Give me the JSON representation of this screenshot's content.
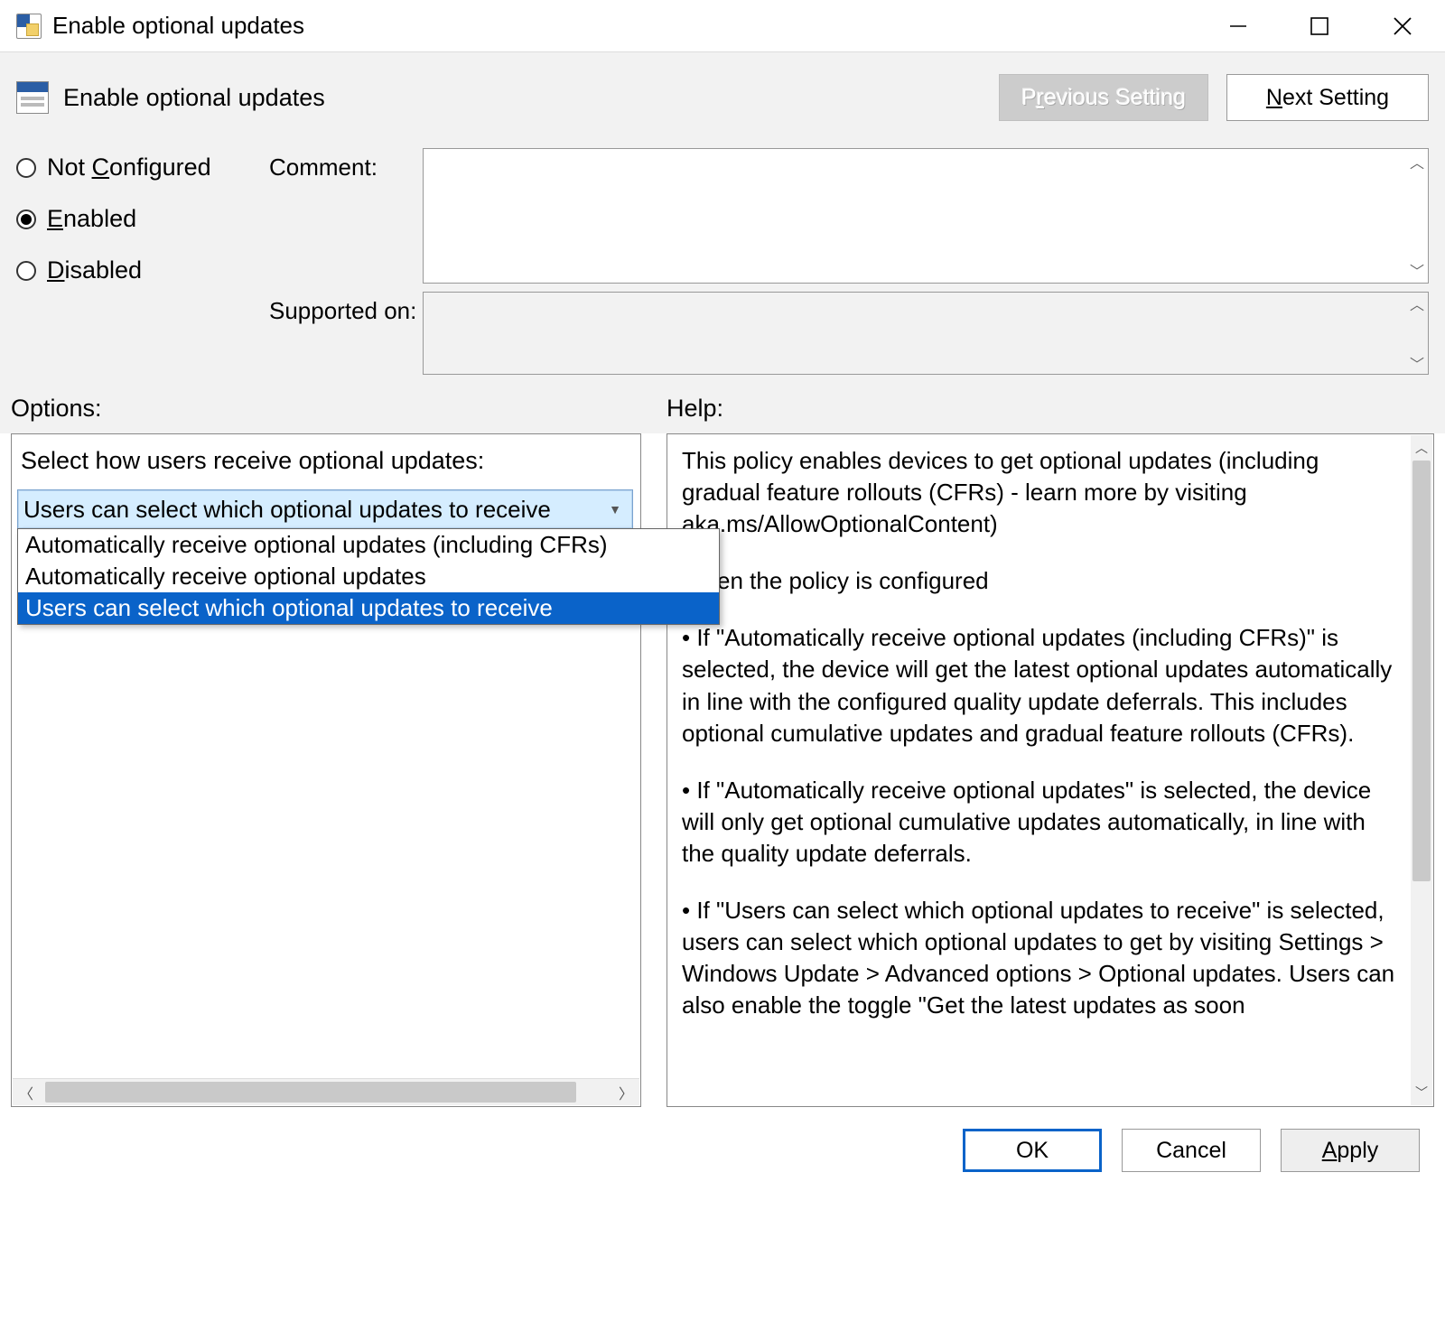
{
  "window": {
    "title": "Enable optional updates"
  },
  "header": {
    "policy_name": "Enable optional updates",
    "prev_label_html": "P<span class='u'>r</span>evious Setting",
    "next_label_html": "<span class='u'>N</span>ext Setting"
  },
  "state": {
    "comment_label": "Comment:",
    "supported_label": "Supported on:",
    "not_configured_html": "Not <span class='u'>C</span>onfigured",
    "enabled_html": "<span class='u'>E</span>nabled",
    "disabled_html": "<span class='u'>D</span>isabled",
    "selected": "enabled",
    "comment_value": "",
    "supported_value": ""
  },
  "panel_headers": {
    "options": "Options:",
    "help": "Help:"
  },
  "options": {
    "dropdown_label": "Select how users receive optional updates:",
    "selected_value": "Users can select which optional updates to receive",
    "items": [
      "Automatically receive optional updates (including CFRs)",
      "Automatically receive optional updates",
      "Users can select which optional updates to receive"
    ],
    "highlighted_index": 2
  },
  "help": {
    "p1": "This policy enables devices to get optional updates (including gradual feature rollouts (CFRs) - learn more by visiting aka.ms/AllowOptionalContent)",
    "p2": "When the policy is configured",
    "p3": "• If \"Automatically receive optional updates (including CFRs)\" is selected, the device will get the latest optional updates automatically in line with the configured quality update deferrals. This includes optional cumulative updates and gradual feature rollouts (CFRs).",
    "p4": "• If \"Automatically receive optional updates\" is selected, the device will only get optional cumulative updates automatically, in line with the quality update deferrals.",
    "p5": "• If \"Users can select which optional updates to receive\" is selected, users can select which optional updates to get by visiting Settings > Windows Update > Advanced options > Optional updates. Users can also enable the toggle \"Get the latest updates as soon"
  },
  "footer": {
    "ok": "OK",
    "cancel": "Cancel",
    "apply_html": "<span class='u'>A</span>pply"
  }
}
